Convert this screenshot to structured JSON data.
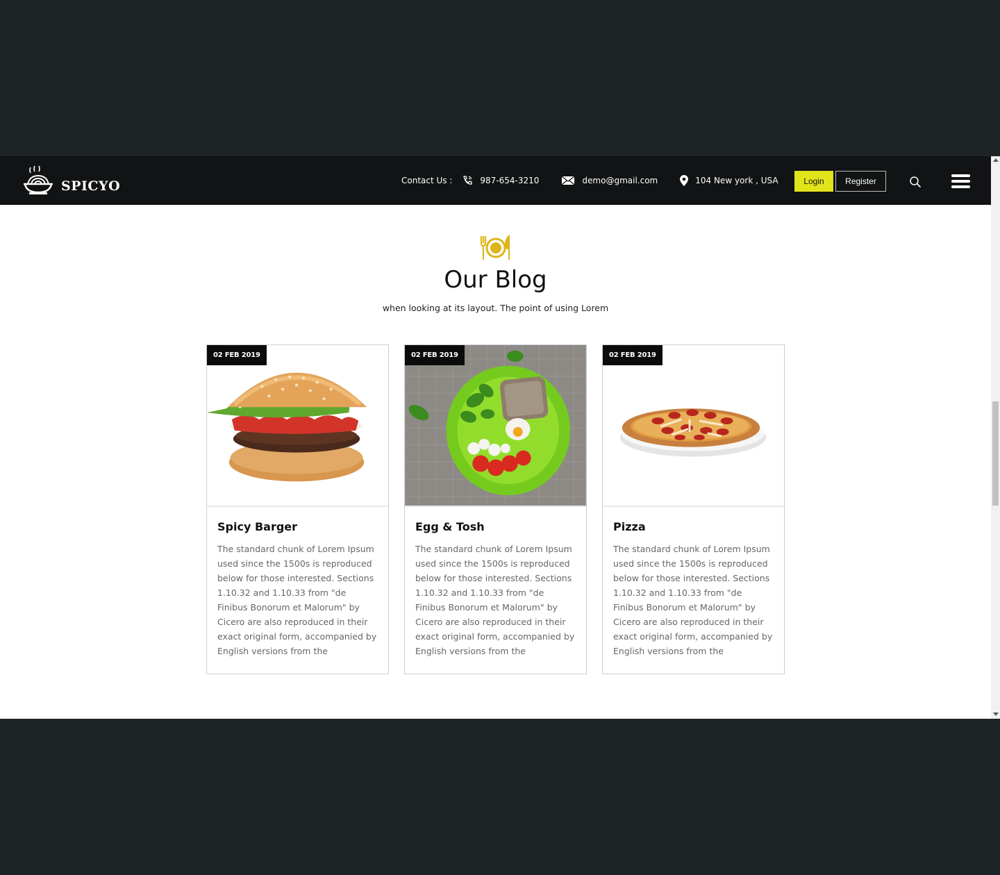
{
  "header": {
    "brand": "SPICYO",
    "contact_label": "Contact Us :",
    "phone": "987-654-3210",
    "email": "demo@gmail.com",
    "address": "104 New york , USA",
    "login_label": "Login",
    "register_label": "Register",
    "accent_color": "#e1e31b"
  },
  "blog": {
    "title": "Our Blog",
    "subtitle": "when looking at its layout. The point of using Lorem",
    "posts": [
      {
        "date": "02 FEB 2019",
        "title": "Spicy Barger",
        "text": "The standard chunk of Lorem Ipsum used since the 1500s is reproduced below for those interested. Sections 1.10.32 and 1.10.33 from \"de Finibus Bonorum et Malorum\" by Cicero are also reproduced in their exact original form, accompanied by English versions from the",
        "image_icon": "burger-image"
      },
      {
        "date": "02 FEB 2019",
        "title": "Egg & Tosh",
        "text": "The standard chunk of Lorem Ipsum used since the 1500s is reproduced below for those interested. Sections 1.10.32 and 1.10.33 from \"de Finibus Bonorum et Malorum\" by Cicero are also reproduced in their exact original form, accompanied by English versions from the",
        "image_icon": "egg-plate-image"
      },
      {
        "date": "02 FEB 2019",
        "title": "Pizza",
        "text": "The standard chunk of Lorem Ipsum used since the 1500s is reproduced below for those interested. Sections 1.10.32 and 1.10.33 from \"de Finibus Bonorum et Malorum\" by Cicero are also reproduced in their exact original form, accompanied by English versions from the",
        "image_icon": "pizza-image"
      }
    ]
  }
}
